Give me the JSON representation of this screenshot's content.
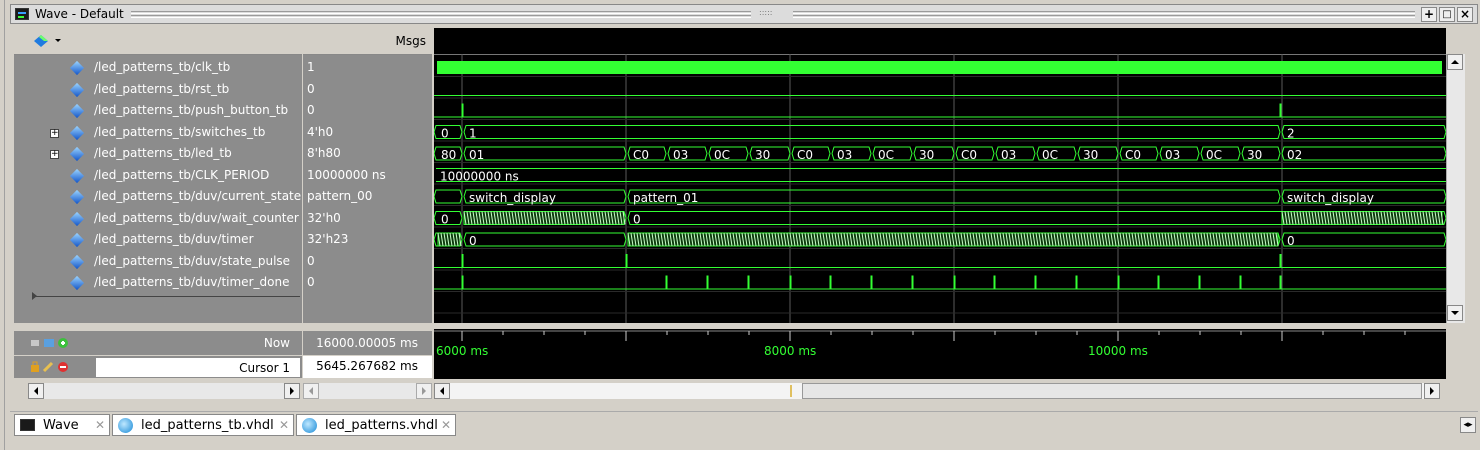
{
  "window": {
    "title": "Wave - Default",
    "buttons": [
      "+",
      "□",
      "×"
    ]
  },
  "header": {
    "msgs_label": "Msgs"
  },
  "signals": [
    {
      "name": "/led_patterns_tb/clk_tb",
      "value": "1",
      "expandable": false
    },
    {
      "name": "/led_patterns_tb/rst_tb",
      "value": "0",
      "expandable": false
    },
    {
      "name": "/led_patterns_tb/push_button_tb",
      "value": "0",
      "expandable": false
    },
    {
      "name": "/led_patterns_tb/switches_tb",
      "value": "4'h0",
      "expandable": true
    },
    {
      "name": "/led_patterns_tb/led_tb",
      "value": "8'h80",
      "expandable": true
    },
    {
      "name": "/led_patterns_tb/CLK_PERIOD",
      "value": "10000000 ns",
      "expandable": false
    },
    {
      "name": "/led_patterns_tb/duv/current_state",
      "value": "pattern_00",
      "expandable": false
    },
    {
      "name": "/led_patterns_tb/duv/wait_counter",
      "value": "32'h0",
      "expandable": false
    },
    {
      "name": "/led_patterns_tb/duv/timer",
      "value": "32'h23",
      "expandable": false
    },
    {
      "name": "/led_patterns_tb/duv/state_pulse",
      "value": "0",
      "expandable": false
    },
    {
      "name": "/led_patterns_tb/duv/timer_done",
      "value": "0",
      "expandable": false
    }
  ],
  "wave_labels": {
    "switches": [
      "0",
      "1",
      "2"
    ],
    "led": [
      "80",
      "01",
      "C0",
      "03",
      "0C",
      "30",
      "C0",
      "03",
      "0C",
      "30",
      "C0",
      "03",
      "0C",
      "30",
      "C0",
      "03",
      "0C",
      "30",
      "02"
    ],
    "clk_period": "10000000 ns",
    "state": [
      "switch_display",
      "pattern_01",
      "switch_display"
    ],
    "wait_counter": [
      "0",
      "0"
    ],
    "timer": [
      "0",
      "0"
    ]
  },
  "status": {
    "now_label": "Now",
    "now_value": "16000.00005 ms",
    "cursor_label": "Cursor 1",
    "cursor_value": "5645.267682 ms"
  },
  "time_axis": {
    "labels": [
      "6000 ms",
      "8000 ms",
      "10000 ms"
    ]
  },
  "tabs": [
    {
      "label": "Wave",
      "icon": "wave-icon"
    },
    {
      "label": "led_patterns_tb.vhdl",
      "icon": "vhdl-file-icon"
    },
    {
      "label": "led_patterns.vhdl",
      "icon": "vhdl-file-icon"
    }
  ],
  "colors": {
    "wave": "#33ff33",
    "background": "#000000",
    "panel": "#8c8c8c"
  }
}
